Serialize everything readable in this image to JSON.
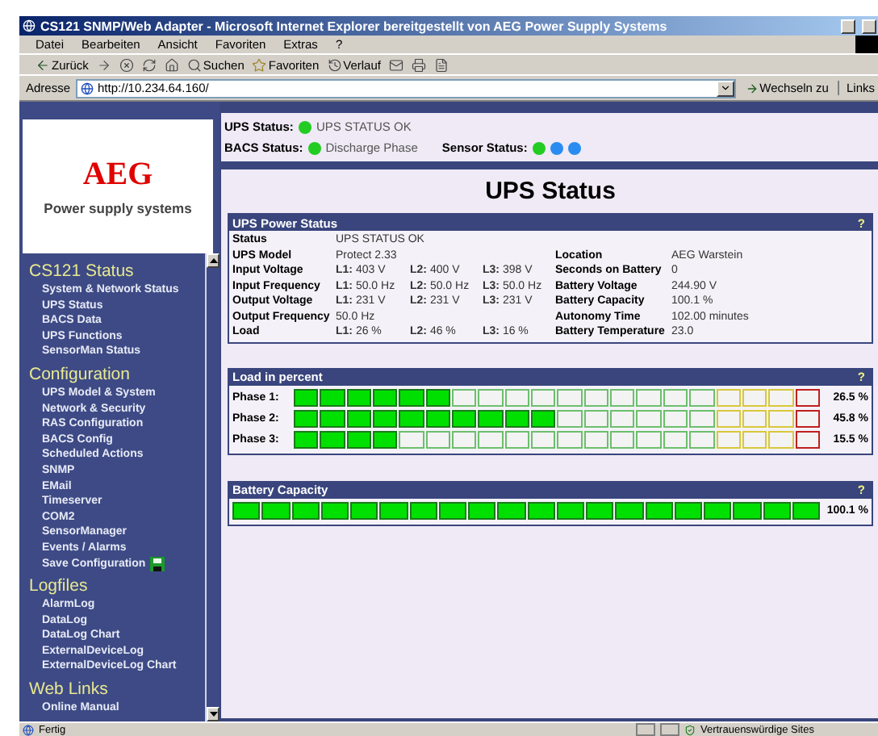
{
  "window": {
    "title": "CS121 SNMP/Web Adapter - Microsoft Internet Explorer bereitgestellt von AEG Power Supply Systems"
  },
  "menu": [
    "Datei",
    "Bearbeiten",
    "Ansicht",
    "Favoriten",
    "Extras",
    "?"
  ],
  "toolbar": [
    {
      "kind": "back",
      "label": "Zurück"
    },
    {
      "kind": "forward"
    },
    {
      "kind": "stop"
    },
    {
      "kind": "refresh"
    },
    {
      "kind": "home"
    },
    {
      "kind": "search",
      "label": "Suchen"
    },
    {
      "kind": "favorites",
      "label": "Favoriten"
    },
    {
      "kind": "history",
      "label": "Verlauf"
    },
    {
      "kind": "mail"
    },
    {
      "kind": "print"
    },
    {
      "kind": "edit"
    }
  ],
  "address": {
    "label": "Adresse",
    "value": "http://10.234.64.160/",
    "go": "Wechseln zu",
    "links": "Links"
  },
  "sidebar": {
    "logo": {
      "brand": "AEG",
      "tagline": "Power supply systems"
    },
    "sections": [
      {
        "title": "CS121 Status",
        "items": [
          {
            "label": "System & Network Status"
          },
          {
            "label": "UPS Status"
          },
          {
            "label": "BACS Data"
          },
          {
            "label": "UPS Functions"
          },
          {
            "label": "SensorMan Status"
          }
        ]
      },
      {
        "title": "Configuration",
        "items": [
          {
            "label": "UPS Model & System"
          },
          {
            "label": "Network & Security"
          },
          {
            "label": "RAS Configuration"
          },
          {
            "label": "BACS Config"
          },
          {
            "label": "Scheduled Actions"
          },
          {
            "label": "SNMP"
          },
          {
            "label": "EMail"
          },
          {
            "label": "Timeserver"
          },
          {
            "label": "COM2"
          },
          {
            "label": "SensorManager"
          },
          {
            "label": "Events / Alarms"
          },
          {
            "label": "Save Configuration",
            "kind": "save"
          }
        ]
      },
      {
        "title": "Logfiles",
        "items": [
          {
            "label": "AlarmLog"
          },
          {
            "label": "DataLog"
          },
          {
            "label": "DataLog Chart"
          },
          {
            "label": "ExternalDeviceLog"
          },
          {
            "label": "ExternalDeviceLog Chart"
          }
        ]
      },
      {
        "title": "Web Links",
        "items": [
          {
            "label": "Online Manual"
          }
        ]
      }
    ]
  },
  "status_panel": {
    "ups": {
      "label": "UPS Status:",
      "color": "#22cc22",
      "text": "UPS STATUS OK"
    },
    "bacs": {
      "label": "BACS Status:",
      "color": "#22cc22",
      "text": "Discharge Phase"
    },
    "sensor": {
      "label": "Sensor Status:",
      "dots": [
        {
          "color": "#22cc22"
        },
        {
          "color": "#2a8cf0"
        },
        {
          "color": "#2a8cf0"
        }
      ]
    }
  },
  "page_title": "UPS Status",
  "power_status": {
    "title": "UPS Power Status",
    "help": "?",
    "rows": [
      {
        "label": "Status",
        "values": [
          "UPS STATUS OK"
        ]
      },
      {
        "label": "UPS Model",
        "values": [
          "Protect 2.33"
        ],
        "key2": "Location",
        "value2": "AEG Warstein"
      },
      {
        "label": "Input Voltage",
        "values": [
          "**L1:** 403 V",
          "**L2:** 400 V",
          "**L3:** 398 V"
        ],
        "key2": "Seconds on Battery",
        "value2": "0"
      },
      {
        "label": "Input Frequency",
        "values": [
          "**L1:** 50.0 Hz",
          "**L2:** 50.0 Hz",
          "**L3:** 50.0 Hz"
        ],
        "key2": "Battery Voltage",
        "value2": "244.90 V"
      },
      {
        "label": "Output Voltage",
        "values": [
          "**L1:** 231 V",
          "**L2:** 231 V",
          "**L3:** 231 V"
        ],
        "key2": "Battery Capacity",
        "value2": "100.1 %"
      },
      {
        "label": "Output Frequency",
        "values": [
          "50.0 Hz"
        ],
        "key2": "Autonomy Time",
        "value2": "102.00 minutes"
      },
      {
        "label": "Load",
        "values": [
          "**L1:** 26 %",
          "**L2:** 46 %",
          "**L3:** 16 %"
        ],
        "key2": "Battery Temperature",
        "value2": "23.0"
      }
    ]
  },
  "load": {
    "title": "Load in percent",
    "help": "?",
    "phases": [
      {
        "label": "Phase 1:",
        "level": 0.3,
        "reading": "26.5 %"
      },
      {
        "label": "Phase 2:",
        "level": 0.5,
        "reading": "45.8 %"
      },
      {
        "label": "Phase 3:",
        "level": 0.2,
        "reading": "15.5 %"
      }
    ]
  },
  "battery": {
    "title": "Battery Capacity",
    "help": "?",
    "level": 1,
    "reading": "100.1 %"
  },
  "status_bar": {
    "text": "Fertig",
    "zone": "Vertrauenswürdige Sites"
  }
}
